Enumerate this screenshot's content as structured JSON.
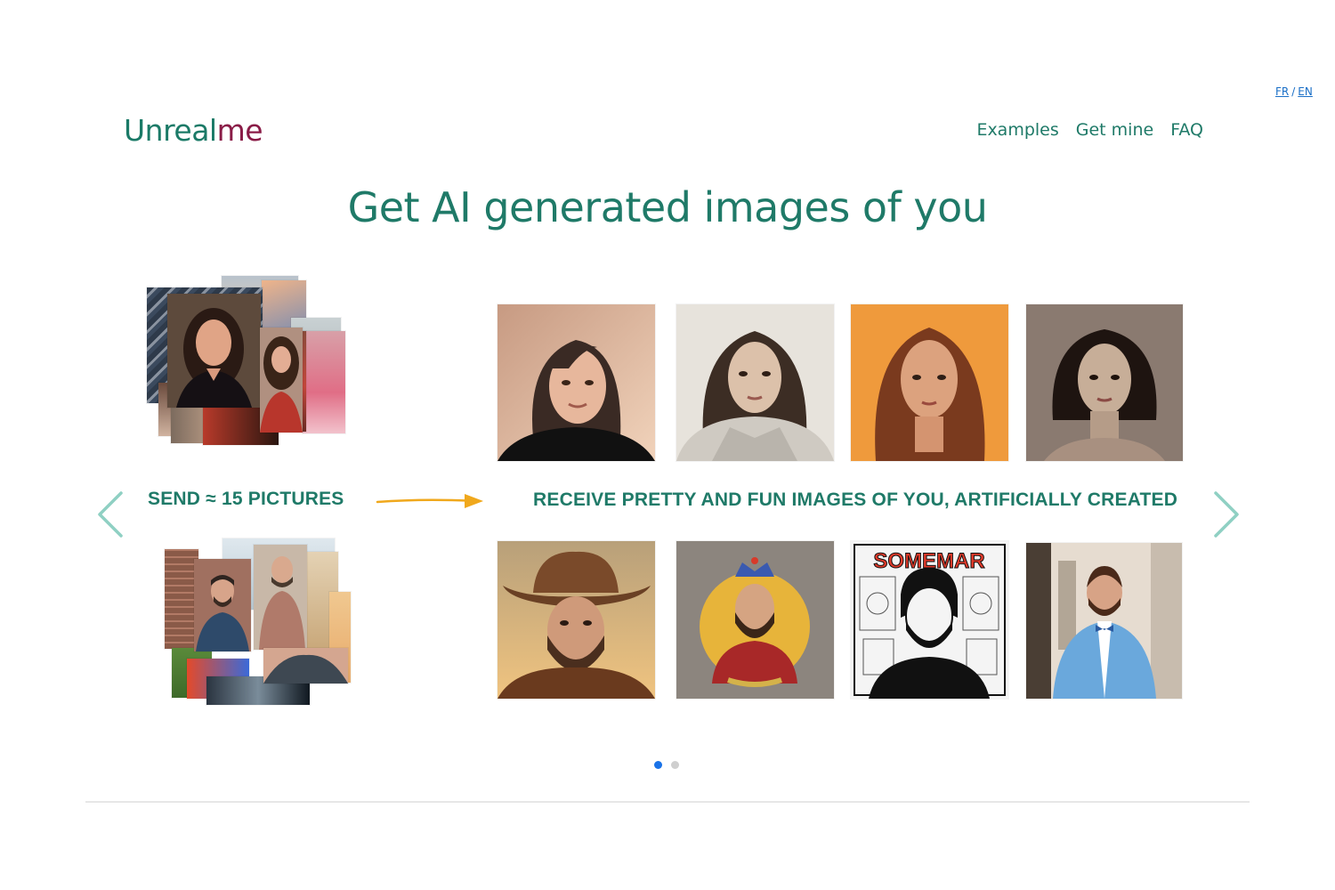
{
  "lang": {
    "fr": "FR",
    "separator": "/",
    "en": "EN"
  },
  "logo": {
    "part1": "Unreal",
    "part2": "me"
  },
  "nav": {
    "examples": "Examples",
    "get_mine": "Get mine",
    "faq": "FAQ"
  },
  "headline": "Get AI generated images of you",
  "carousel": {
    "send_label": "SEND ≈ 15 PICTURES",
    "receive_label": "RECEIVE PRETTY AND FUN IMAGES OF YOU, ARTIFICIALLY CREATED",
    "poster_title": "SOMEMAR",
    "slide_count": 2,
    "active_slide": 1
  },
  "colors": {
    "brand": "#1f7a68",
    "logo_accent": "#8a1c47",
    "arrow": "#f0a81c",
    "dot_active": "#1a73e8"
  },
  "icons": [
    "chevron-left-icon",
    "chevron-right-icon",
    "arrow-right-icon"
  ]
}
